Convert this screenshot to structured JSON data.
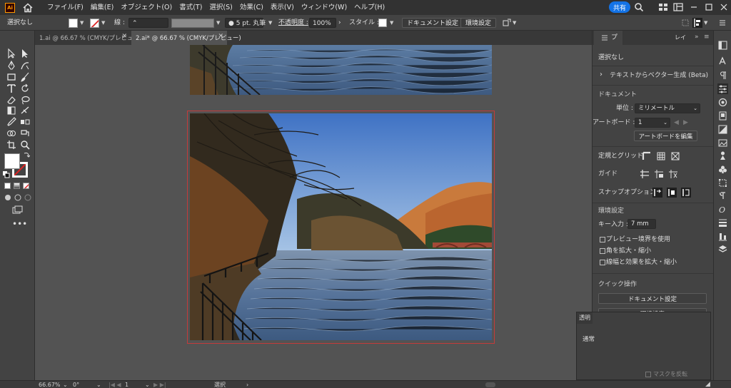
{
  "menubar": {
    "logo_text": "Ai",
    "items": [
      "ファイル(F)",
      "編集(E)",
      "オブジェクト(O)",
      "書式(T)",
      "選択(S)",
      "効果(C)",
      "表示(V)",
      "ウィンドウ(W)",
      "ヘルプ(H)"
    ],
    "share_label": "共有",
    "icons": [
      "home-icon",
      "search-icon",
      "arrange-documents-icon",
      "workspace-icon",
      "minimize-icon",
      "maximize-icon",
      "close-icon"
    ]
  },
  "controlbar": {
    "selection_label": "選択なし",
    "stroke_label": "線 :",
    "brush_label": "5 pt. 丸筆",
    "opacity_label": "不透明度 :",
    "opacity_value": "100%",
    "style_label": "スタイル :",
    "doc_setup_button": "ドキュメント設定",
    "preferences_button": "環境設定"
  },
  "tabs": [
    {
      "label": "1.ai @ 66.67 % (CMYK/プレビュー)",
      "active": false
    },
    {
      "label": "2.ai* @ 66.67 % (CMYK/プレビュー)",
      "active": true
    }
  ],
  "properties": {
    "tabs": [
      "プ",
      "レイ"
    ],
    "selection": "選択なし",
    "text_to_vector": "テキストからベクター生成 (Beta)",
    "document_header": "ドキュメント",
    "unit_label": "単位 :",
    "unit_value": "ミリメートル",
    "artboard_label": "アートボード :",
    "artboard_value": "1",
    "edit_artboard_button": "アートボードを編集",
    "rulers_grid_label": "定規とグリッド",
    "guides_label": "ガイド",
    "snap_label": "スナップオプション",
    "prefs_header": "環境設定",
    "key_increment_label": "キー入力 :",
    "key_increment_value": "7 mm",
    "checkboxes": [
      "プレビュー境界を使用",
      "角を拡大・縮小",
      "線幅と効果を拡大・縮小"
    ],
    "quick_actions_header": "クイック操作",
    "quick_doc_setup": "ドキュメント設定",
    "quick_prefs": "環境設定"
  },
  "floating_panel": {
    "title": "透明",
    "blend_label": "通常",
    "mask_label": "マスクを反転"
  },
  "status": {
    "zoom": "66.67%",
    "rotation": "0°",
    "artboard_number": "1",
    "tool": "選択"
  },
  "colors": {
    "accent": "#1473e6",
    "artboard_outline": "#c43b3b",
    "logo": "#ff9a00"
  }
}
